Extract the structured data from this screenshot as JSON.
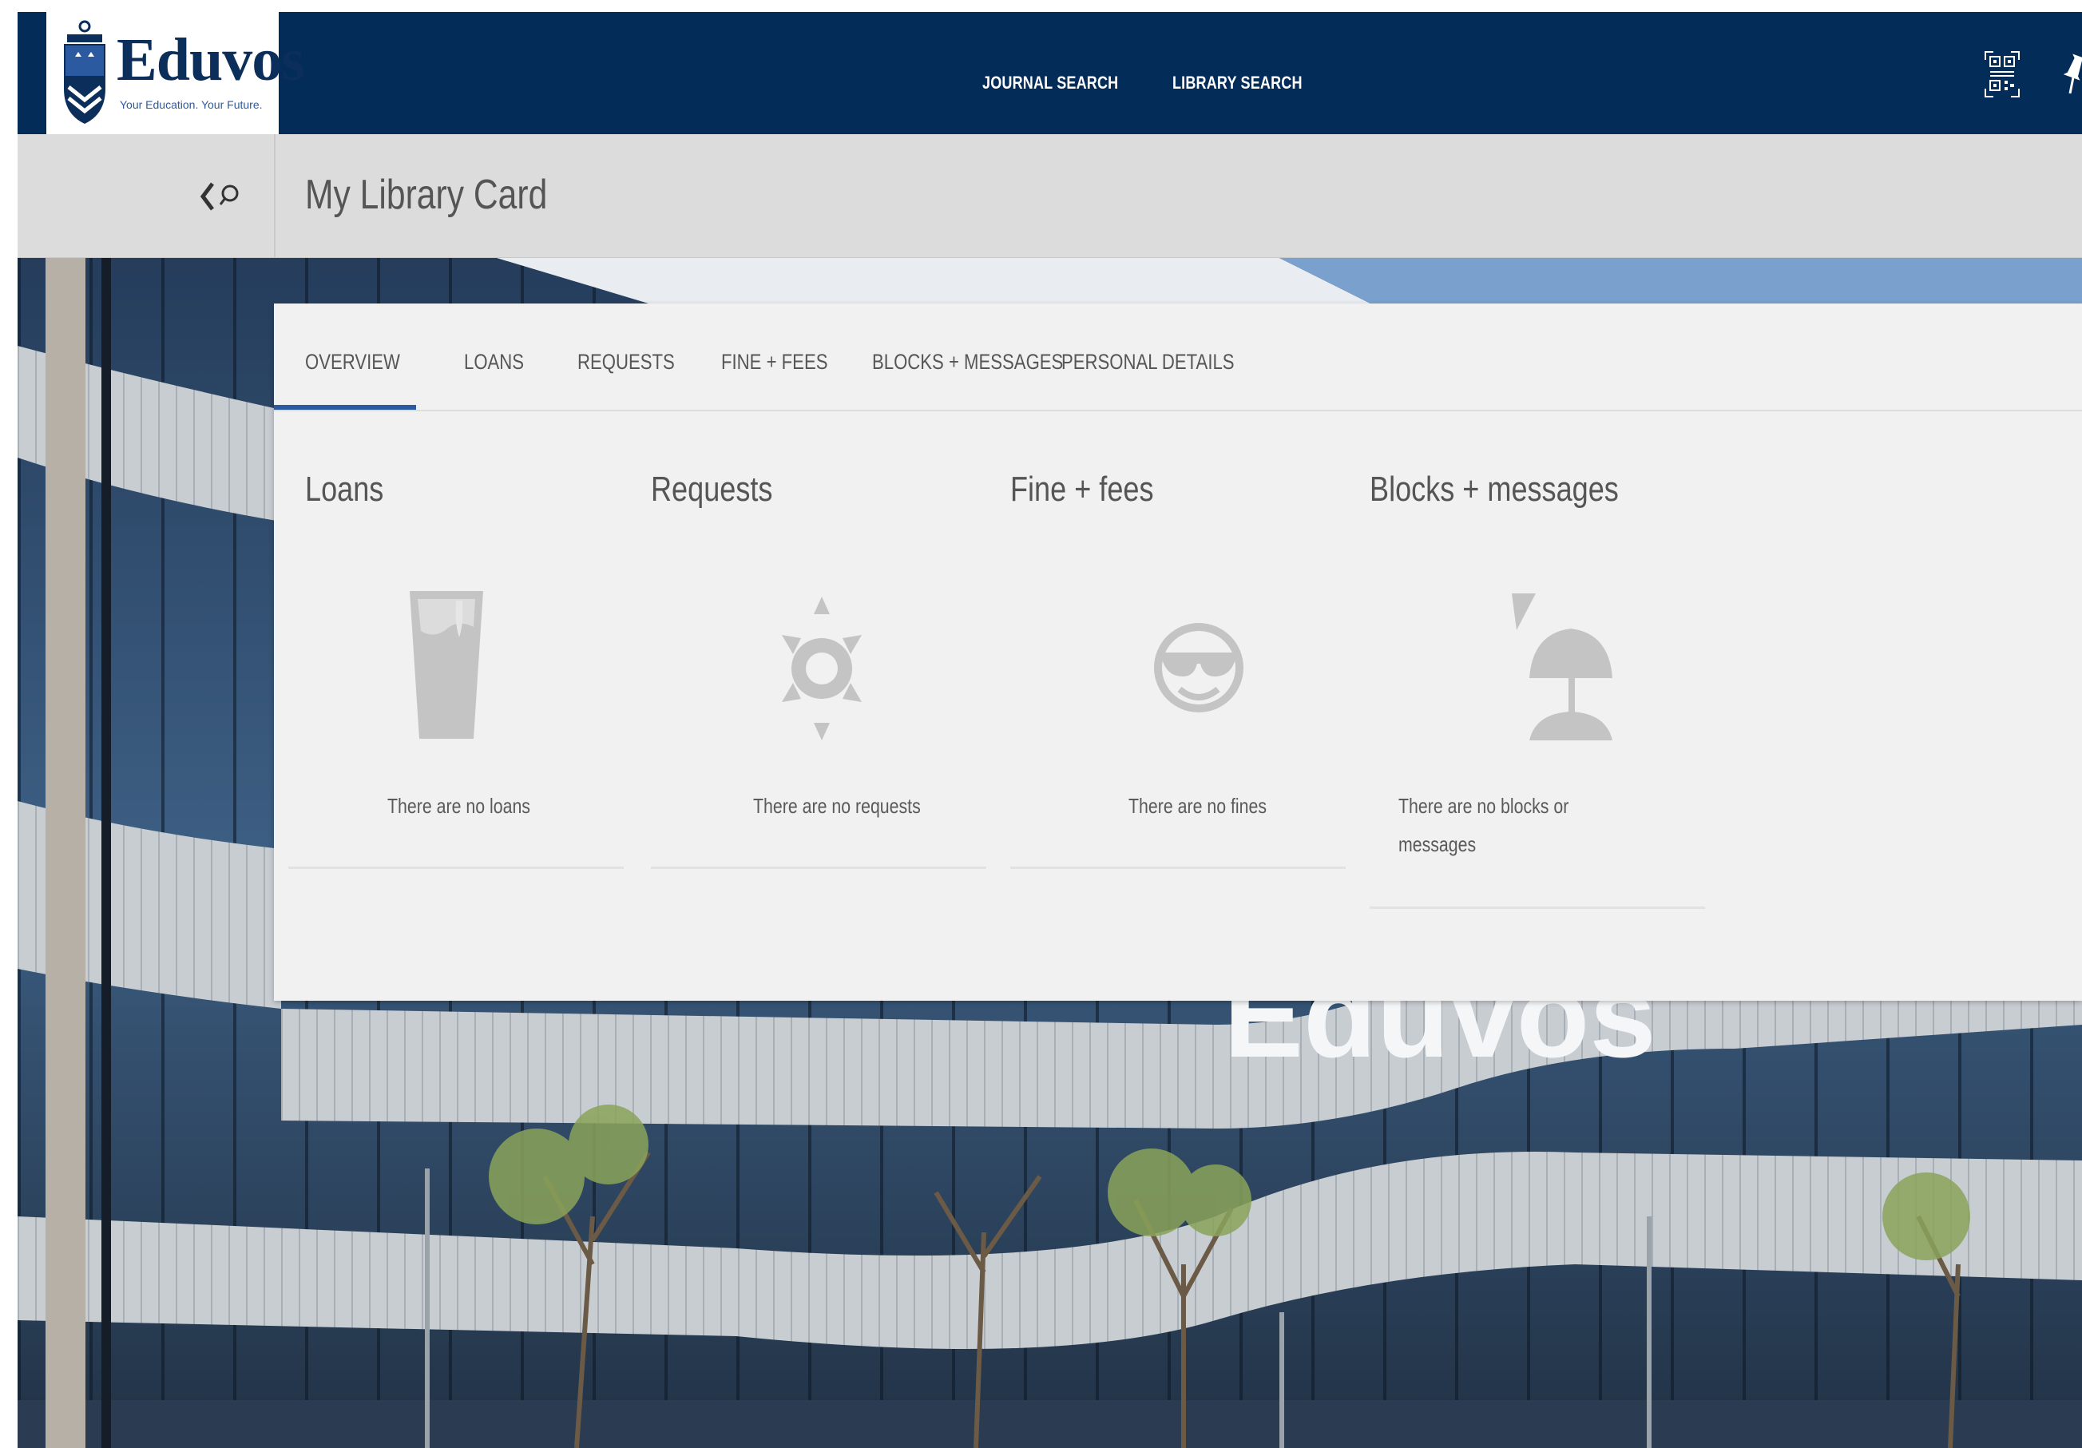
{
  "header": {
    "brand": "Eduvos",
    "tagline": "Your Education. Your Future.",
    "nav": [
      {
        "label": "JOURNAL SEARCH"
      },
      {
        "label": "LIBRARY SEARCH"
      }
    ]
  },
  "subheader": {
    "title": "My Library Card"
  },
  "tabs": [
    {
      "label": "OVERVIEW",
      "active": true
    },
    {
      "label": "LOANS",
      "active": false
    },
    {
      "label": "REQUESTS",
      "active": false
    },
    {
      "label": "FINE + FEES",
      "active": false
    },
    {
      "label": "BLOCKS + MESSAGES",
      "active": false
    },
    {
      "label": "PERSONAL DETAILS",
      "active": false
    }
  ],
  "overview": [
    {
      "title": "Loans",
      "icon": "glass-icon",
      "message": "There are no loans"
    },
    {
      "title": "Requests",
      "icon": "sun-icon",
      "message": "There are no requests"
    },
    {
      "title": "Fine + fees",
      "icon": "sunglasses-smiley-icon",
      "message": "There are no fines"
    },
    {
      "title": "Blocks + messages",
      "icon": "beach-umbrella-icon",
      "message_line1": "There are no blocks or",
      "message_line2": "messages"
    }
  ],
  "colors": {
    "header_bg": "#042c58",
    "subheader_bg": "#dcdcdc",
    "panel_bg": "#f1f1f1",
    "accent": "#2c5aa0",
    "icon_gray": "#c4c4c4"
  },
  "photo_sign": "Eduvos"
}
